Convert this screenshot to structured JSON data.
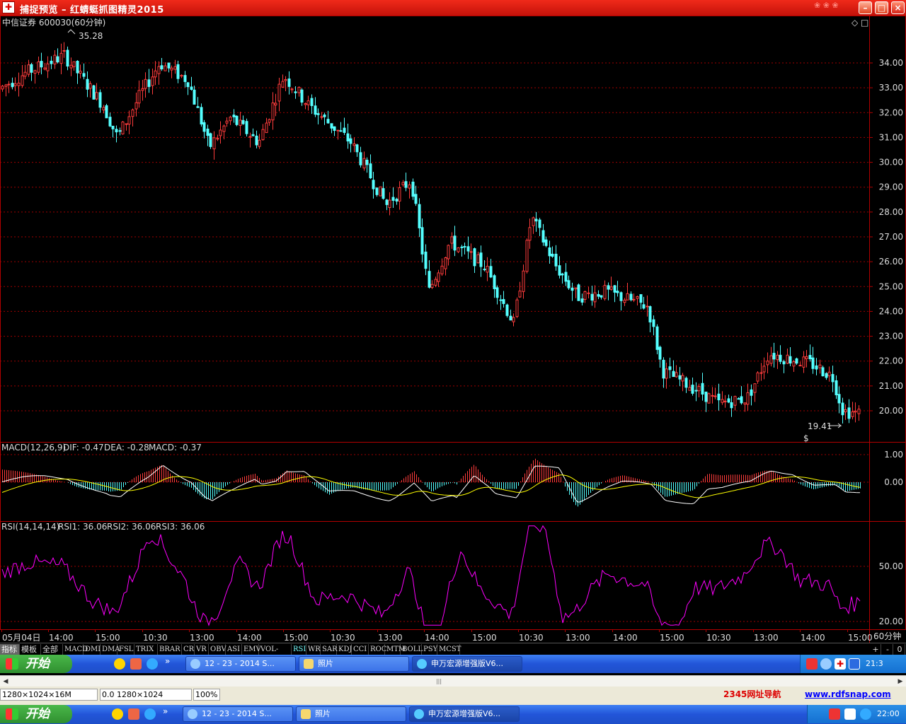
{
  "window": {
    "title": "捕捉预览 – 红蜻蜓抓图精灵2015",
    "icon": "app-icon",
    "buttons": [
      "minimize",
      "maximize",
      "close"
    ]
  },
  "stock": {
    "header": "中信证券 600030(60分钟)",
    "high_label": "35.28",
    "low_label": "19.41",
    "corner_icons": "◇ □",
    "price_ticks": [
      "34.00",
      "33.00",
      "32.00",
      "31.00",
      "30.00",
      "29.00",
      "28.00",
      "27.00",
      "26.00",
      "25.00",
      "24.00",
      "23.00",
      "22.00",
      "21.00",
      "20.00"
    ],
    "period_label": "60分钟",
    "time_ticks": [
      "05月04日",
      "14:00",
      "15:00",
      "10:30",
      "13:00",
      "14:00",
      "15:00",
      "10:30",
      "13:00",
      "14:00",
      "15:00",
      "10:30",
      "13:00",
      "14:00",
      "15:00",
      "10:30",
      "13:00",
      "14:00",
      "15:00"
    ],
    "up_color": "#ff3c3c",
    "down_color": "#54ffff"
  },
  "macd": {
    "name": "MACD(12,26,9)",
    "dif": "DIF: -0.47",
    "dea": "DEA: -0.28",
    "macd": "MACD: -0.37",
    "ticks": [
      "1.00",
      "0.00"
    ],
    "dif_color": "#ffffff",
    "dea_color": "#ffff00",
    "macd_color": "#ff00ff"
  },
  "rsi": {
    "name": "RSI(14,14,14)",
    "rsi1": "RSI1: 36.06",
    "rsi2": "RSI2: 36.06",
    "rsi3": "RSI3: 36.06",
    "ticks": [
      "50.00",
      "20.00"
    ],
    "color": "#ff00ff"
  },
  "tabs": [
    "指标",
    "模板",
    "全部",
    "MACD",
    "DMI",
    "DMA",
    "FSL",
    "TRIX",
    "BRAR",
    "CR",
    "VR",
    "OBV",
    "ASI",
    "EMV",
    "VOL-TDX",
    "RSI",
    "WR",
    "SAR",
    "KDJ",
    "CCI",
    "ROC",
    "MTM",
    "BOLL",
    "PSY",
    "MCST"
  ],
  "tab_controls": [
    "+",
    "-",
    "0"
  ],
  "taskbar_top": {
    "start": "开始",
    "tasks": [
      "12 - 23 - 2014 S...",
      "照片",
      "申万宏源增强版V6..."
    ],
    "clock": "21:3"
  },
  "taskbar_bottom": {
    "start": "开始",
    "tasks": [
      "12 - 23 - 2014 S...",
      "照片",
      "申万宏源增强版V6..."
    ],
    "clock": "22:00"
  },
  "status": {
    "size": "1280×1024×16M",
    "coords": "0.0 1280×1024",
    "zoom": "100%",
    "link1": "2345网址导航",
    "link2": "www.rdfsnap.com"
  }
}
